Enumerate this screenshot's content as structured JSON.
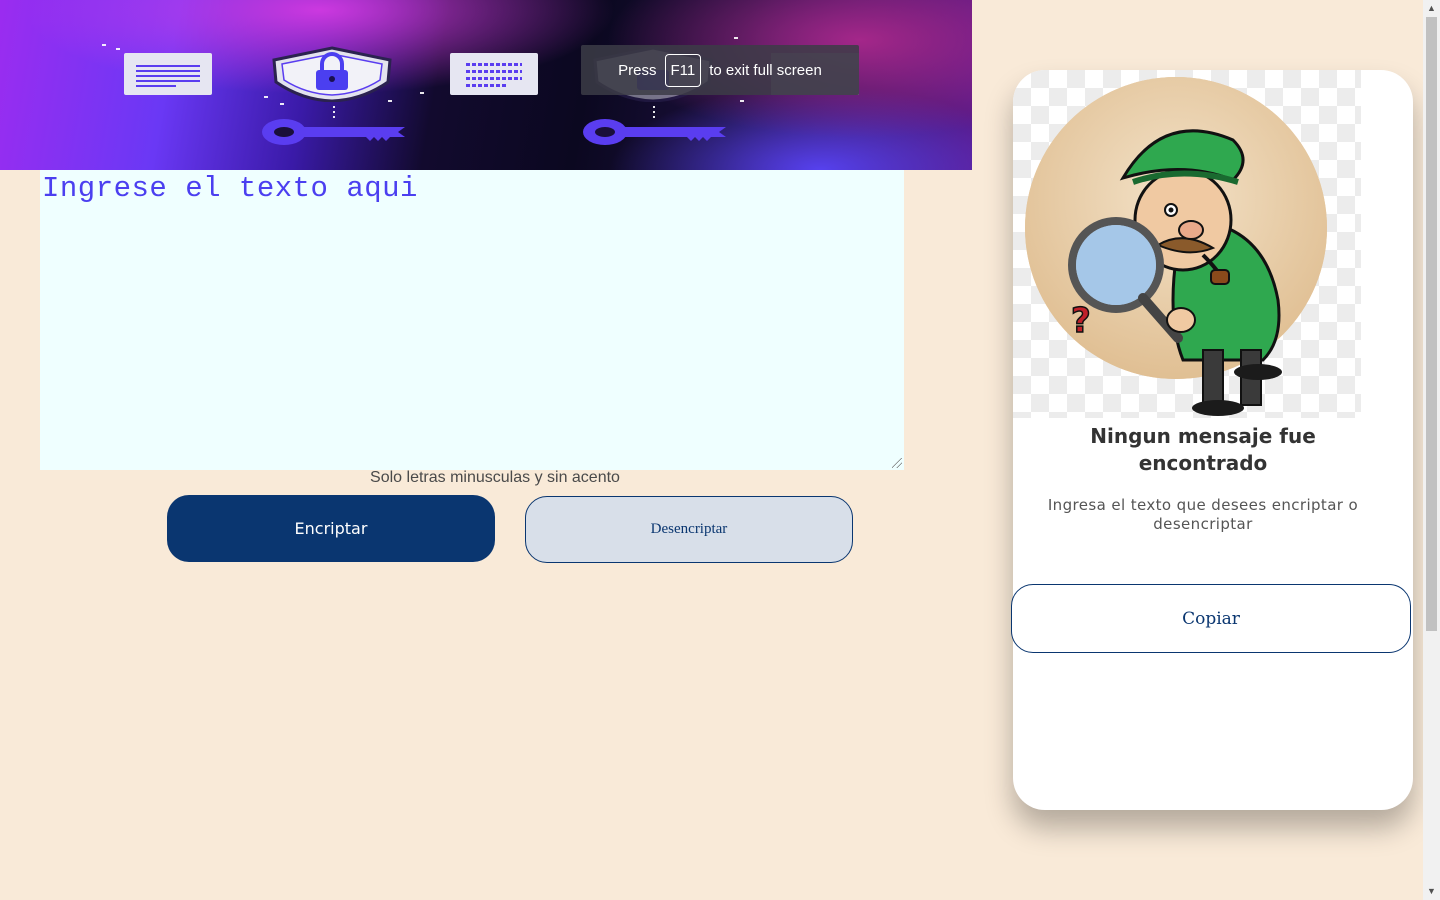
{
  "fullscreen_toast": {
    "press": "Press",
    "key": "F11",
    "suffix": "to exit full screen"
  },
  "editor": {
    "placeholder": "Ingrese el texto aqui",
    "hint": "Solo letras minusculas y sin acento"
  },
  "actions": {
    "encrypt_label": "Encriptar",
    "decrypt_label": "Desencriptar"
  },
  "output_panel": {
    "title": "Ningun mensaje fue encontrado",
    "subtitle": "Ingresa el texto que desees encriptar o desencriptar",
    "copy_label": "Copiar"
  },
  "colors": {
    "page_background": "#f9ead8",
    "primary": "#0a3670",
    "textarea_background": "#efffff",
    "placeholder_text": "#4b3ff0"
  },
  "icons": {
    "banner": [
      "document-icon",
      "shield-lock-icon",
      "key-icon",
      "cipher-document-icon"
    ],
    "illustration": "detective-magnifier-illustration"
  }
}
